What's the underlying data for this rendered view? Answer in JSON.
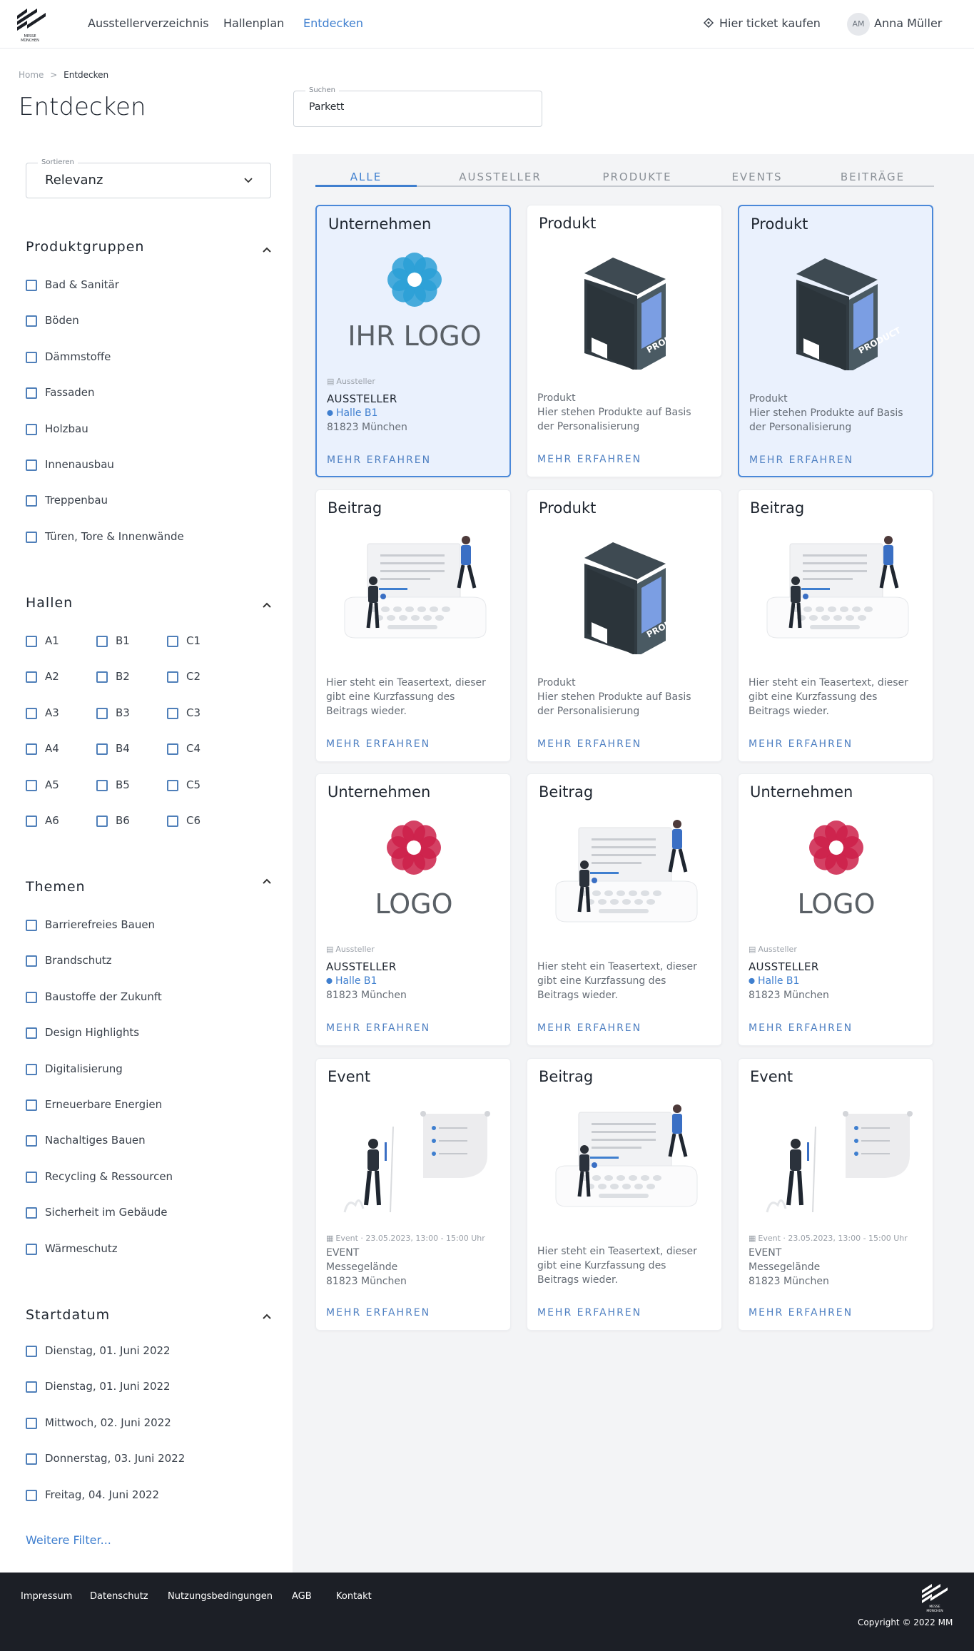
{
  "header": {
    "logo_text": [
      "MESSE",
      "MÜNCHEN"
    ],
    "nav": [
      "Ausstellerverzeichnis",
      "Hallenplan",
      "Entdecken"
    ],
    "ticket": "Hier ticket kaufen",
    "avatar_initials": "AM",
    "user_name": "Anna Müller"
  },
  "breadcrumb": {
    "home": "Home",
    "separator": ">",
    "current": "Entdecken"
  },
  "page_title": "Entdecken",
  "search": {
    "label": "Suchen",
    "value": "Parkett"
  },
  "sort": {
    "label": "Sortieren",
    "value": "Relevanz"
  },
  "filters": {
    "produktgruppen": {
      "title": "Produktgruppen",
      "items": [
        "Bad & Sanitär",
        "Böden",
        "Dämmstoffe",
        "Fassaden",
        "Holzbau",
        "Innenausbau",
        "Treppenbau",
        "Türen, Tore & Innenwände"
      ]
    },
    "hallen": {
      "title": "Hallen",
      "items": [
        "A1",
        "B1",
        "C1",
        "A2",
        "B2",
        "C2",
        "A3",
        "B3",
        "C3",
        "A4",
        "B4",
        "C4",
        "A5",
        "B5",
        "C5",
        "A6",
        "B6",
        "C6"
      ]
    },
    "themen": {
      "title": "Themen",
      "items": [
        "Barrierefreies Bauen",
        "Brandschutz",
        "Baustoffe der Zukunft",
        "Design Highlights",
        "Digitalisierung",
        "Erneuerbare Energien",
        "Nachaltiges Bauen",
        "Recycling & Ressourcen",
        "Sicherheit im Gebäude",
        "Wärmeschutz"
      ]
    },
    "startdatum": {
      "title": "Startdatum",
      "items": [
        "Dienstag, 01. Juni 2022",
        "Dienstag, 01. Juni 2022",
        "Mittwoch, 02. Juni 2022",
        "Donnerstag, 03. Juni 2022",
        "Freitag, 04. Juni 2022"
      ]
    }
  },
  "more_filters": "Weitere Filter...",
  "tabs": [
    "ALLE",
    "AUSSTELLER",
    "PRODUKTE",
    "EVENTS",
    "BEITRÄGE"
  ],
  "cards": [
    {
      "kind": "company",
      "title": "Unternehmen",
      "logo": "IHR LOGO",
      "logo_color": "#2a9fd6",
      "highlight": true,
      "meta": "Aussteller",
      "name": "AUSSTELLER",
      "hall": "Halle B1",
      "city": "81823 München",
      "cta": "MEHR ERFAHREN"
    },
    {
      "kind": "product",
      "title": "Produkt",
      "box_label": "PRODUCT",
      "highlight": false,
      "lines": [
        "Produkt",
        "Hier stehen Produkte auf Basis",
        "der Personalisierung"
      ],
      "cta": "MEHR ERFAHREN"
    },
    {
      "kind": "product",
      "title": "Produkt",
      "box_label": "PRODUCT",
      "highlight": true,
      "lines": [
        "Produkt",
        "Hier stehen Produkte auf Basis",
        "der Personalisierung"
      ],
      "cta": "MEHR ERFAHREN"
    },
    {
      "kind": "post",
      "title": "Beitrag",
      "highlight": false,
      "lines": [
        "Hier steht ein Teasertext, dieser",
        "gibt eine Kurzfassung des",
        "Beitrags wieder."
      ],
      "cta": "MEHR ERFAHREN"
    },
    {
      "kind": "product",
      "title": "Produkt",
      "box_label": "PRODUCT",
      "highlight": false,
      "lines": [
        "Produkt",
        "Hier stehen Produkte auf Basis",
        "der Personalisierung"
      ],
      "cta": "MEHR ERFAHREN"
    },
    {
      "kind": "post",
      "title": "Beitrag",
      "highlight": false,
      "lines": [
        "Hier steht ein Teasertext, dieser",
        "gibt eine Kurzfassung des",
        "Beitrags wieder."
      ],
      "cta": "MEHR ERFAHREN"
    },
    {
      "kind": "company",
      "title": "Unternehmen",
      "logo": "LOGO",
      "logo_color": "#cc2049",
      "highlight": false,
      "meta": "Aussteller",
      "name": "AUSSTELLER",
      "hall": "Halle B1",
      "city": "81823 München",
      "cta": "MEHR ERFAHREN"
    },
    {
      "kind": "post",
      "title": "Beitrag",
      "highlight": false,
      "lines": [
        "Hier steht ein Teasertext, dieser",
        "gibt eine Kurzfassung des",
        "Beitrags wieder."
      ],
      "cta": "MEHR ERFAHREN"
    },
    {
      "kind": "company",
      "title": "Unternehmen",
      "logo": "LOGO",
      "logo_color": "#cc2049",
      "highlight": false,
      "meta": "Aussteller",
      "name": "AUSSTELLER",
      "hall": "Halle B1",
      "city": "81823 München",
      "cta": "MEHR ERFAHREN"
    },
    {
      "kind": "event",
      "title": "Event",
      "highlight": false,
      "meta": "Event · 23.05.2023, 13:00 - 15:00 Uhr",
      "name": "EVENT",
      "place": "Messegelände",
      "city": "81823 München",
      "cta": "MEHR ERFAHREN"
    },
    {
      "kind": "post",
      "title": "Beitrag",
      "highlight": false,
      "lines": [
        "Hier steht ein Teasertext, dieser",
        "gibt eine Kurzfassung des",
        "Beitrags wieder."
      ],
      "cta": "MEHR ERFAHREN"
    },
    {
      "kind": "event",
      "title": "Event",
      "highlight": false,
      "meta": "Event · 23.05.2023, 13:00 - 15:00 Uhr",
      "name": "EVENT",
      "place": "Messegelände",
      "city": "81823 München",
      "cta": "MEHR ERFAHREN"
    }
  ],
  "footer": {
    "links": [
      "Impressum",
      "Datenschutz",
      "Nutzungsbedingungen",
      "AGB",
      "Kontakt"
    ],
    "copyright": "Copyright © 2022 MM",
    "logo_text": [
      "MESSE",
      "MÜNCHEN"
    ]
  },
  "colors": {
    "accent": "#3f7fcf",
    "footer_bg": "#1c1f26",
    "highlight_bg": "#eaf1fd"
  }
}
